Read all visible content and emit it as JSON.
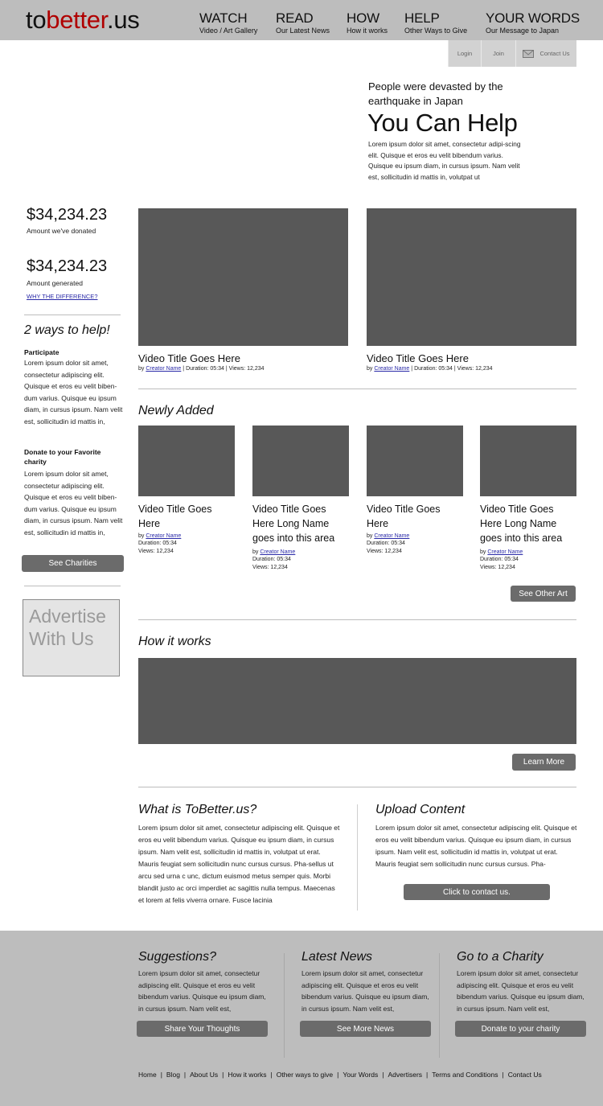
{
  "logo": {
    "part1": "to",
    "part2": "better",
    "part3": ".us"
  },
  "nav": [
    {
      "title": "WATCH",
      "sub": "Video / Art Gallery"
    },
    {
      "title": "READ",
      "sub": "Our Latest News"
    },
    {
      "title": "HOW",
      "sub": "How it works"
    },
    {
      "title": "HELP",
      "sub": "Other Ways to Give"
    },
    {
      "title": "YOUR WORDS",
      "sub": "Our Message to Japan"
    }
  ],
  "utility": {
    "login": "Login",
    "join": "Join",
    "contact": "Contact Us"
  },
  "hero": {
    "subtitle": "People were devasted by the earthquake in Japan",
    "title": "You Can Help",
    "body": "Lorem ipsum dolor sit amet, consectetur adipi-scing elit. Quisque et eros eu velit bibendum varius. Quisque eu ipsum diam, in cursus ipsum. Nam velit est, sollicitudin id mattis in, volutpat ut"
  },
  "sidebar": {
    "donated_amount": "$34,234.23",
    "donated_label": "Amount we've donated",
    "generated_amount": "$34,234.23",
    "generated_label": "Amount generated",
    "why_link": "WHY THE DIFFERENCE?",
    "ways_title": "2 ways to help!",
    "participate_heading": "Participate",
    "participate_body": "Lorem ipsum dolor sit amet, consectetur adipiscing elit. Quisque et eros eu velit biben-dum varius. Quisque eu ipsum diam, in cursus ipsum. Nam velit est, sollicitudin id mattis in,",
    "donate_heading": "Donate to your Favorite charity",
    "donate_body": "Lorem ipsum dolor sit amet, consectetur adipiscing elit. Quisque et eros eu velit biben-dum varius. Quisque eu ipsum diam, in cursus ipsum. Nam velit est, sollicitudin id mattis in,",
    "charities_button": "See Charities",
    "advert": "Advertise With Us"
  },
  "featured": [
    {
      "title": "Video Title Goes Here",
      "by": "by",
      "creator": "Creator Name",
      "duration": "Duration: 05:34",
      "views": "Views: 12,234",
      "sep": "|"
    },
    {
      "title": "Video Title Goes Here",
      "by": "by",
      "creator": "Creator Name",
      "duration": "Duration: 05:34",
      "views": "Views: 12,234",
      "sep": "|"
    }
  ],
  "newly_added": {
    "title": "Newly Added",
    "items": [
      {
        "title": "Video Title Goes Here",
        "by": "by",
        "creator": "Creator Name",
        "duration": "Duration: 05:34",
        "views": "Views: 12,234"
      },
      {
        "title": "Video Title Goes Here Long Name goes into this area",
        "by": "by",
        "creator": "Creator Name",
        "duration": "Duration: 05:34",
        "views": "Views: 12,234"
      },
      {
        "title": "Video Title Goes Here",
        "by": "by",
        "creator": "Creator Name",
        "duration": "Duration: 05:34",
        "views": "Views: 12,234"
      },
      {
        "title": "Video Title Goes Here Long Name goes into this area",
        "by": "by",
        "creator": "Creator Name",
        "duration": "Duration: 05:34",
        "views": "Views: 12,234"
      }
    ],
    "button": "See Other Art"
  },
  "how_it_works": {
    "title": "How it works",
    "button": "Learn More"
  },
  "what_is": {
    "title": "What is ToBetter.us?",
    "body": "Lorem ipsum dolor sit amet, consectetur adipiscing elit. Quisque et eros eu velit bibendum varius. Quisque eu ipsum diam, in cursus ipsum. Nam velit est, sollicitudin id mattis in, volutpat ut erat. Mauris feugiat sem sollicitudin nunc cursus cursus. Pha-sellus ut arcu sed urna c    unc, dictum euismod metus semper quis. Morbi blandit justo ac orci imperdiet ac sagittis nulla tempus. Maecenas et lorem at felis viverra ornare. Fusce lacinia"
  },
  "upload": {
    "title": "Upload Content",
    "body": "Lorem ipsum dolor sit amet, consectetur adipiscing elit. Quisque et eros eu velit bibendum varius. Quisque eu ipsum diam, in cursus ipsum. Nam velit est, sollicitudin id mattis in, volutpat ut erat. Mauris feugiat sem sollicitudin nunc cursus cursus. Pha-",
    "button": "Click to contact us."
  },
  "footer": {
    "columns": [
      {
        "title": "Suggestions?",
        "body": "Lorem ipsum dolor sit amet, consectetur adipiscing elit. Quisque et eros eu velit bibendum varius. Quisque eu ipsum diam, in cursus ipsum. Nam velit est,",
        "button": "Share Your Thoughts"
      },
      {
        "title": "Latest News",
        "body": "Lorem ipsum dolor sit amet, consectetur adipiscing elit. Quisque et eros eu velit bibendum varius. Quisque eu ipsum diam, in cursus ipsum. Nam velit est,",
        "button": "See More News"
      },
      {
        "title": "Go to a Charity",
        "body": "Lorem ipsum dolor sit amet, consectetur adipiscing elit. Quisque et eros eu velit bibendum varius. Quisque eu ipsum diam, in cursus ipsum. Nam velit est,",
        "button": "Donate to your charity"
      }
    ],
    "links": [
      "Home",
      "Blog",
      "About Us",
      "How it works",
      "Other ways to give",
      "Your Words",
      "Advertisers",
      "Terms and Conditions",
      "Contact Us"
    ],
    "link_sep": "|"
  },
  "colors": {
    "header_bg": "#bdbdbd",
    "logo_accent": "#b00000",
    "placeholder": "#585858",
    "button": "#6b6b6b",
    "link": "#2a2aa8"
  },
  "icons": {
    "contact": "envelope-icon"
  }
}
